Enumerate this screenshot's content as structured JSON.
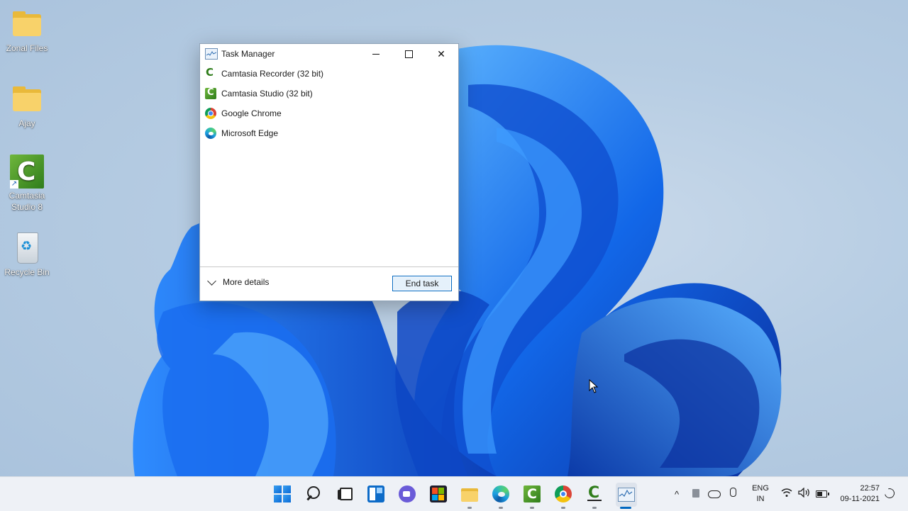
{
  "desktop": {
    "icons": [
      {
        "label": "Zonal Files",
        "type": "folder-icon"
      },
      {
        "label": "Ajay",
        "type": "folder-icon"
      },
      {
        "label": "Camtasia Studio 8",
        "type": "camtasia-icon"
      },
      {
        "label": "Recycle Bin",
        "type": "recycle-bin-icon"
      }
    ]
  },
  "task_manager": {
    "title": "Task Manager",
    "processes": [
      {
        "name": "Camtasia Recorder (32 bit)",
        "icon": "camtasia-recorder-icon"
      },
      {
        "name": "Camtasia Studio (32 bit)",
        "icon": "camtasia-studio-icon"
      },
      {
        "name": "Google Chrome",
        "icon": "chrome-icon"
      },
      {
        "name": "Microsoft Edge",
        "icon": "edge-icon"
      }
    ],
    "more_details_label": "More details",
    "end_task_label": "End task"
  },
  "taskbar": {
    "pinned": [
      "start-icon",
      "search-icon",
      "task-view-icon",
      "widgets-icon",
      "chat-icon",
      "store-icon",
      "file-explorer-icon",
      "edge-icon",
      "camtasia-studio-icon",
      "chrome-icon",
      "camtasia-recorder-icon",
      "task-manager-icon"
    ],
    "language_line1": "ENG",
    "language_line2": "IN",
    "time": "22:57",
    "date": "09-11-2021"
  },
  "colors": {
    "accent": "#0067c0",
    "wallpaper_blue": "#0a5ad6"
  }
}
